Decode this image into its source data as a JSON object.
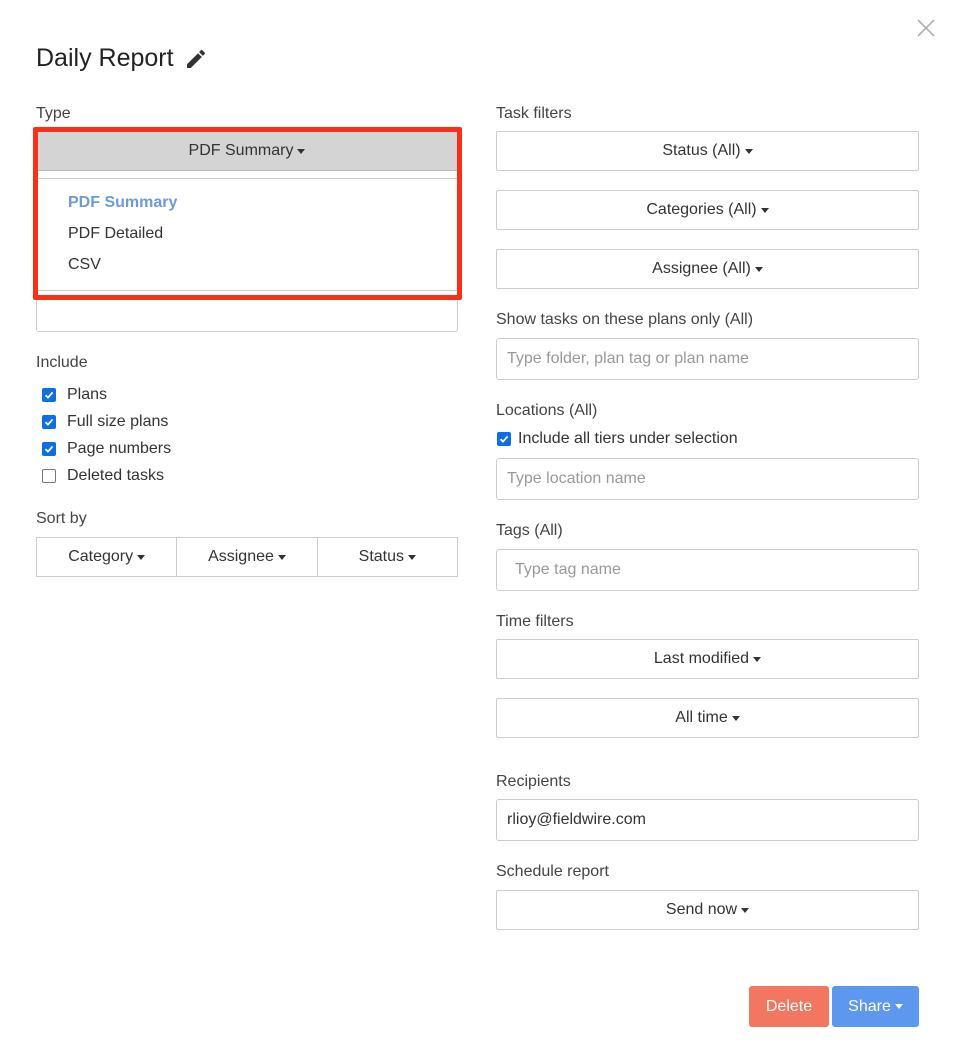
{
  "dialog": {
    "title": "Daily Report"
  },
  "left": {
    "type_label": "Type",
    "type_selected": "PDF Summary",
    "type_options": [
      "PDF Summary",
      "PDF Detailed",
      "CSV"
    ],
    "include_label": "Include",
    "include": [
      {
        "label": "Plans",
        "checked": true
      },
      {
        "label": "Full size plans",
        "checked": true
      },
      {
        "label": "Page numbers",
        "checked": true
      },
      {
        "label": "Deleted tasks",
        "checked": false
      }
    ],
    "sort_label": "Sort by",
    "sort_options": [
      "Category",
      "Assignee",
      "Status"
    ]
  },
  "right": {
    "task_filters_label": "Task filters",
    "status_btn": "Status (All)",
    "categories_btn": "Categories (All)",
    "assignee_btn": "Assignee (All)",
    "plans_label": "Show tasks on these plans only (All)",
    "plans_placeholder": "Type folder, plan tag or plan name",
    "locations_label": "Locations (All)",
    "include_tiers_label": "Include all tiers under selection",
    "include_tiers_checked": true,
    "location_placeholder": "Type location name",
    "tags_label": "Tags (All)",
    "tags_placeholder": "Type tag name",
    "time_filters_label": "Time filters",
    "last_modified_btn": "Last modified",
    "all_time_btn": "All time",
    "recipients_label": "Recipients",
    "recipients_value": "rlioy@fieldwire.com",
    "schedule_label": "Schedule report",
    "send_now_btn": "Send now"
  },
  "footer": {
    "delete_label": "Delete",
    "share_label": "Share"
  },
  "colors": {
    "highlight": "#f7301c",
    "active_option": "#6f9ad7",
    "delete": "#f37660",
    "share": "#5e97ee",
    "checkbox": "#0d6ee6"
  }
}
